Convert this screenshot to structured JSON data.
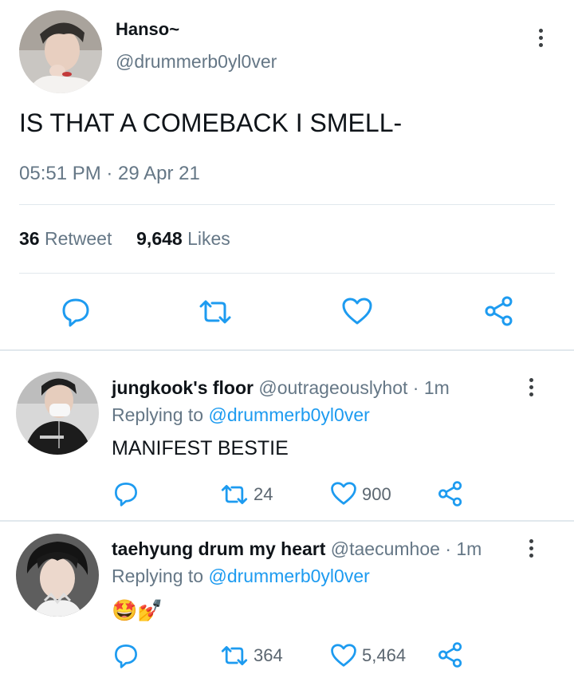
{
  "tweet": {
    "display_name": "Hanso~",
    "handle": "@drummerb0yl0ver",
    "text": "IS THAT A COMEBACK I SMELL-",
    "timestamp": "05:51 PM · 29 Apr 21",
    "retweet_count": "36",
    "retweet_label": "Retweet",
    "likes_count": "9,648",
    "likes_label": "Likes",
    "actions": [
      "reply-icon",
      "retweet-icon",
      "heart-icon",
      "share-icon"
    ]
  },
  "replies": [
    {
      "display_name": "jungkook's floor",
      "handle": "@outrageouslyhot",
      "time": "· 1m",
      "replying_prefix": "Replying to",
      "replying_handle": "@drummerb0yl0ver",
      "text": "MANIFEST BESTIE",
      "retweets": "24",
      "likes": "900"
    },
    {
      "display_name": "taehyung drum my heart",
      "handle": "@taecumhoe",
      "time": "· 1m",
      "replying_prefix": "Replying to",
      "replying_handle": "@drummerb0yl0ver",
      "text": "🤩💅",
      "retweets": "364",
      "likes": "5,464"
    }
  ],
  "colors": {
    "link": "#1d9bf0",
    "muted": "#657786",
    "divider": "#e1e8ed",
    "icon": "#1d9bf0"
  }
}
